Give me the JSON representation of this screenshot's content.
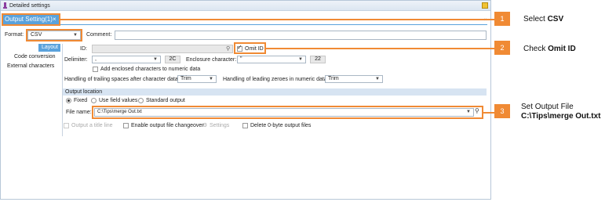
{
  "window": {
    "title": "Detailed settings"
  },
  "tab": {
    "label": "Output Setting(1)"
  },
  "colors": {
    "accent": "#5aa2dc",
    "callout": "#f08a34"
  },
  "format": {
    "label": "Format:",
    "value": "CSV"
  },
  "comment": {
    "label": "Comment:",
    "value": ""
  },
  "side_tabs": [
    "Layout",
    "Code conversion",
    "External characters"
  ],
  "id": {
    "label": "ID:",
    "value": ""
  },
  "omit_id": {
    "label": "Omit ID",
    "checked": true
  },
  "delimiter": {
    "label": "Delimiter:",
    "value": ",",
    "code": "2C"
  },
  "enclosure": {
    "label": "Enclosure character:",
    "value": "\"",
    "code": "22"
  },
  "add_enclosed": {
    "label": "Add enclosed characters to numeric data",
    "checked": false
  },
  "trailing": {
    "label": "Handling of trailing spaces after character data:",
    "value": "Trim"
  },
  "leading": {
    "label": "Handling of leading zeroes in numeric data:",
    "value": "Trim"
  },
  "output_location": {
    "heading": "Output location",
    "options": [
      "Fixed",
      "Use field values",
      "Standard output"
    ],
    "selected": "Fixed",
    "file_name_label": "File name:",
    "file_name_value": "C:\\Tips\\merge Out.txt"
  },
  "bottom": {
    "output_title_line": "Output a title line",
    "enable_changeover": "Enable output file changeover",
    "settings": "Settings",
    "delete_zero_byte": "Delete 0-byte output files"
  },
  "callouts": [
    {
      "number": "1",
      "text_prefix": "Select ",
      "text_bold": "CSV"
    },
    {
      "number": "2",
      "text_prefix": "Check ",
      "text_bold": "Omit ID"
    },
    {
      "number": "3",
      "text_line1": "Set Output File",
      "text_line2": "C:\\Tips\\merge Out.txt"
    }
  ]
}
